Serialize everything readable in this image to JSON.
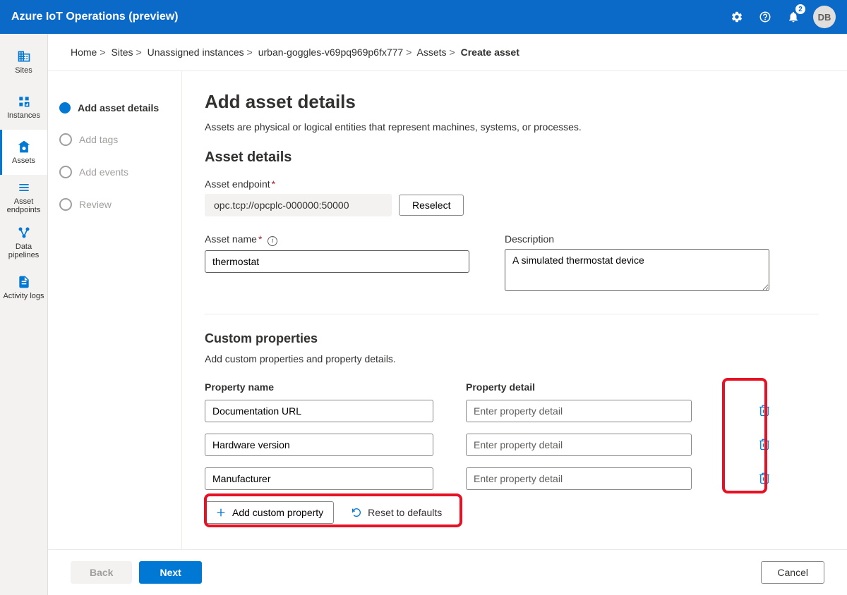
{
  "header": {
    "app_title": "Azure IoT Operations (preview)",
    "notif_count": "2",
    "avatar_initials": "DB"
  },
  "nav": {
    "items": [
      {
        "label": "Sites"
      },
      {
        "label": "Instances"
      },
      {
        "label": "Assets"
      },
      {
        "label": "Asset endpoints"
      },
      {
        "label": "Data pipelines"
      },
      {
        "label": "Activity logs"
      }
    ]
  },
  "breadcrumb": {
    "parts": [
      "Home",
      "Sites",
      "Unassigned instances",
      "urban-goggles-v69pq969p6fx777",
      "Assets"
    ],
    "current": "Create asset"
  },
  "wizard": {
    "steps": [
      {
        "label": "Add asset details",
        "active": true
      },
      {
        "label": "Add tags",
        "active": false
      },
      {
        "label": "Add events",
        "active": false
      },
      {
        "label": "Review",
        "active": false
      }
    ]
  },
  "form": {
    "page_title": "Add asset details",
    "subtitle": "Assets are physical or logical entities that represent machines, systems, or processes.",
    "section_asset_details": "Asset details",
    "endpoint_label": "Asset endpoint",
    "endpoint_value": "opc.tcp://opcplc-000000:50000",
    "reselect_label": "Reselect",
    "name_label": "Asset name",
    "name_value": "thermostat",
    "description_label": "Description",
    "description_value": "A simulated thermostat device",
    "section_custom": "Custom properties",
    "custom_subtitle": "Add custom properties and property details.",
    "col_prop_name": "Property name",
    "col_prop_detail": "Property detail",
    "prop_detail_placeholder": "Enter property detail",
    "properties": [
      {
        "name": "Documentation URL",
        "detail": ""
      },
      {
        "name": "Hardware version",
        "detail": ""
      },
      {
        "name": "Manufacturer",
        "detail": ""
      }
    ],
    "add_custom_label": "Add custom property",
    "reset_label": "Reset to defaults"
  },
  "footer": {
    "back_label": "Back",
    "next_label": "Next",
    "cancel_label": "Cancel"
  }
}
